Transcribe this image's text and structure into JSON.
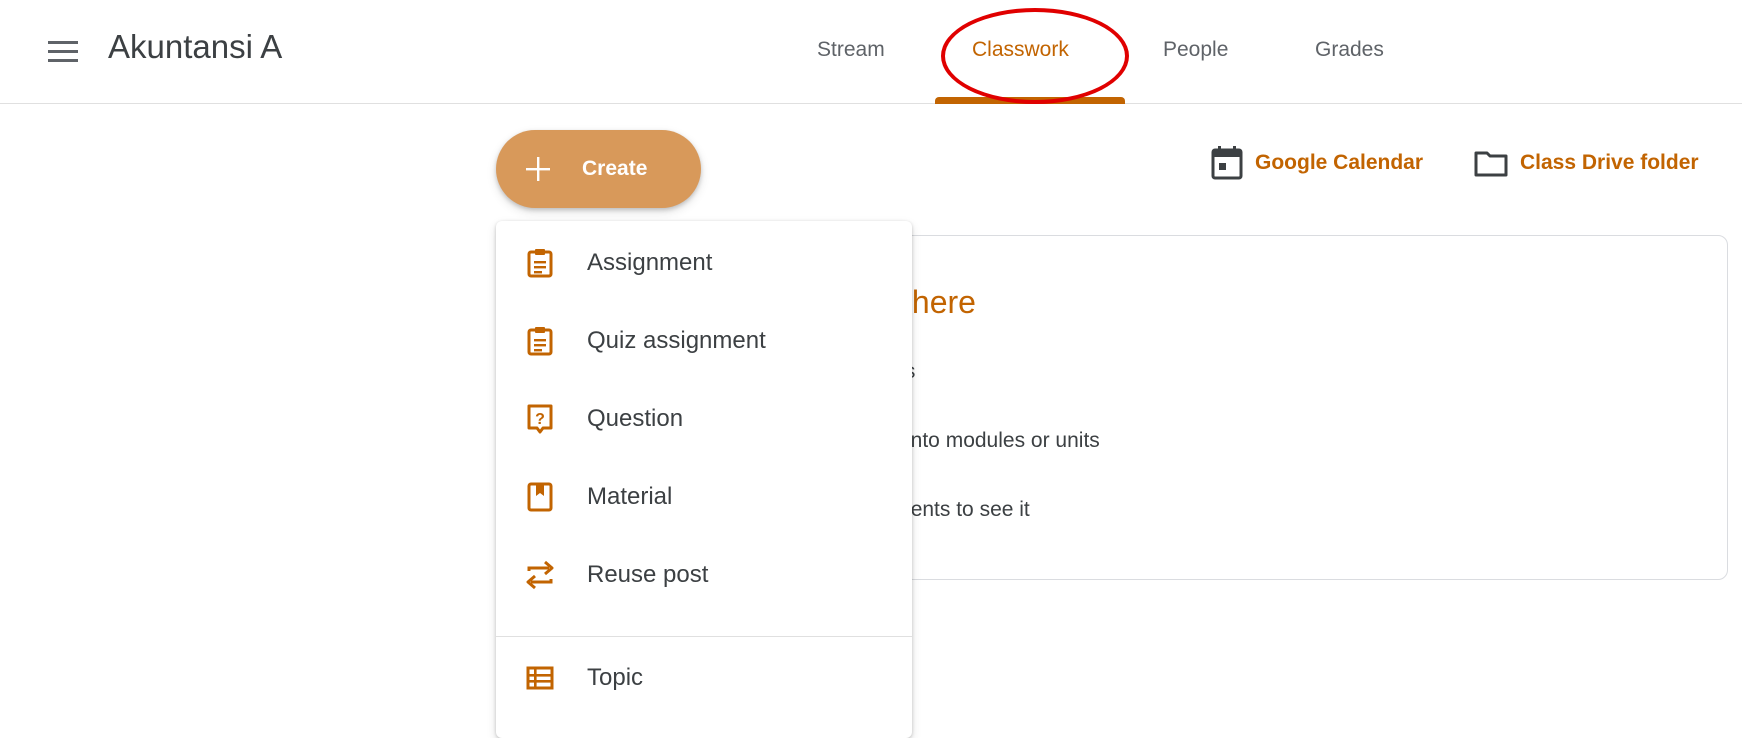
{
  "header": {
    "menu_icon": "hamburger-menu-icon",
    "class_title": "Akuntansi A",
    "tabs": [
      {
        "label": "Stream",
        "active": false
      },
      {
        "label": "Classwork",
        "active": true
      },
      {
        "label": "People",
        "active": false
      },
      {
        "label": "Grades",
        "active": false
      }
    ]
  },
  "toolbar": {
    "create_label": "Create",
    "create_icon": "plus-icon",
    "calendar_label": "Google Calendar",
    "calendar_icon": "calendar-icon",
    "drive_label": "Class Drive folder",
    "drive_icon": "folder-icon"
  },
  "card": {
    "headline_fragment": "ss here",
    "lines": [
      "tions",
      "ork into modules or units",
      " students to see it"
    ]
  },
  "create_menu": {
    "items": [
      {
        "label": "Assignment",
        "icon": "assignment-icon"
      },
      {
        "label": "Quiz assignment",
        "icon": "quiz-assignment-icon"
      },
      {
        "label": "Question",
        "icon": "question-icon"
      },
      {
        "label": "Material",
        "icon": "material-icon"
      },
      {
        "label": "Reuse post",
        "icon": "reuse-icon"
      },
      {
        "label": "Topic",
        "icon": "topic-icon"
      }
    ]
  },
  "colors": {
    "accent": "#c26401",
    "create_button": "#d8995a",
    "annotation": "#e00000"
  }
}
